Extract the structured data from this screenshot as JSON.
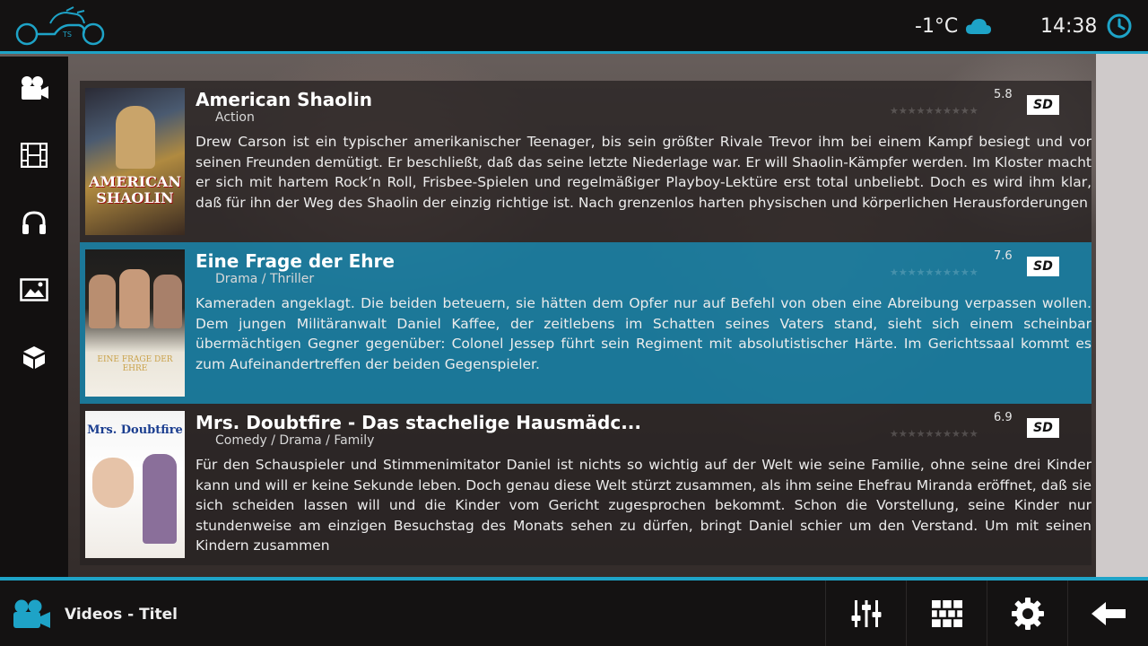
{
  "topbar": {
    "temperature": "-1°C",
    "time": "14:38"
  },
  "sidebar": {
    "items": [
      {
        "icon": "movie-camera-icon"
      },
      {
        "icon": "film-strip-icon"
      },
      {
        "icon": "headphones-icon"
      },
      {
        "icon": "picture-icon"
      },
      {
        "icon": "addons-box-icon"
      }
    ]
  },
  "movies": [
    {
      "title": "American Shaolin",
      "genre": "Action",
      "rating": "5.8",
      "quality": "SD",
      "poster_text": "AMERICAN SHAOLIN",
      "plot": "Drew Carson ist ein typischer amerikanischer Teenager, bis sein größter Rivale Trevor ihm bei einem Kampf besiegt und vor seinen Freunden demütigt. Er beschließt, daß das seine letzte Niederlage war. Er will Shaolin-Kämpfer werden. Im Kloster macht er sich mit hartem Rock’n Roll, Frisbee-Spielen und regelmäßiger Playboy-Lektüre erst total unbeliebt. Doch es wird ihm klar, daß für ihn der Weg des Shaolin der einzig richtige ist. Nach grenzenlos harten physischen und körperlichen Herausforderungen"
    },
    {
      "title": "Eine Frage der Ehre",
      "genre": "Drama / Thriller",
      "rating": "7.6",
      "quality": "SD",
      "poster_text": "EINE FRAGE DER EHRE",
      "plot": "Kameraden angeklagt. Die beiden beteuern, sie hätten dem Opfer nur auf Befehl von oben eine Abreibung verpassen wollen. Dem jungen Militäranwalt Daniel Kaffee, der zeitlebens im Schatten seines Vaters stand, sieht sich einem scheinbar übermächtigen Gegner gegenüber: Colonel Jessep führt sein Regiment mit absolutistischer Härte. Im Gerichtssaal kommt es zum Aufeinandertreffen der beiden Gegenspieler."
    },
    {
      "title": "Mrs. Doubtfire - Das stachelige Hausmädc...",
      "genre": "Comedy / Drama / Family",
      "rating": "6.9",
      "quality": "SD",
      "poster_text": "Mrs. Doubtfire",
      "plot": "Für den Schauspieler und Stimmenimitator Daniel ist nichts so wichtig auf der Welt wie seine Familie, ohne seine drei Kinder kann und will er keine Sekunde leben. Doch genau diese Welt stürzt zusammen, als ihm seine Ehefrau Miranda eröffnet, daß sie sich scheiden lassen will und die Kinder vom Gericht zugesprochen bekommt. Schon die Vorstellung, seine Kinder nur stundenweise am einzigen Besuchstag des Monats sehen zu dürfen, bringt Daniel schier um den Verstand. Um mit seinen Kindern zusammen"
    }
  ],
  "bottombar": {
    "section_label": "Videos - Titel"
  },
  "colors": {
    "accent": "#1ea3c7",
    "selected_row": "#1680a5"
  }
}
